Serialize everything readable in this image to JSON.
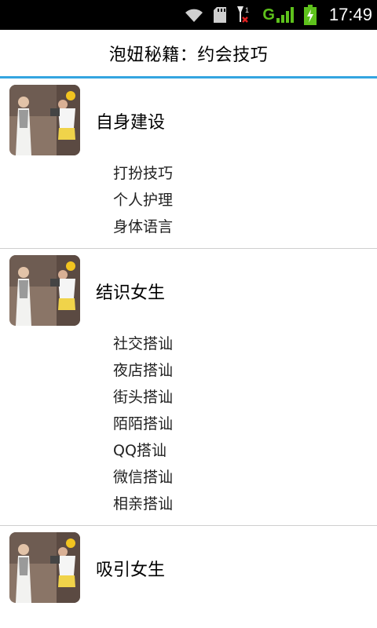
{
  "status_bar": {
    "time": "17:49",
    "signal_label": "G",
    "icons": [
      "wifi-icon",
      "sd-card-icon",
      "no-signal-icon",
      "mobile-signal-icon",
      "battery-charging-icon"
    ]
  },
  "header": {
    "title": "泡妞秘籍：约会技巧"
  },
  "colors": {
    "accent": "#33a5e0",
    "status_bar_bg": "#000000",
    "divider": "#cfcfcf"
  },
  "sections": [
    {
      "title": "自身建设",
      "items": [
        "打扮技巧",
        "个人护理",
        "身体语言"
      ]
    },
    {
      "title": "结识女生",
      "items": [
        "社交搭讪",
        "夜店搭讪",
        "街头搭讪",
        "陌陌搭讪",
        "QQ搭讪",
        "微信搭讪",
        "相亲搭讪"
      ]
    },
    {
      "title": "吸引女生",
      "items": []
    }
  ]
}
